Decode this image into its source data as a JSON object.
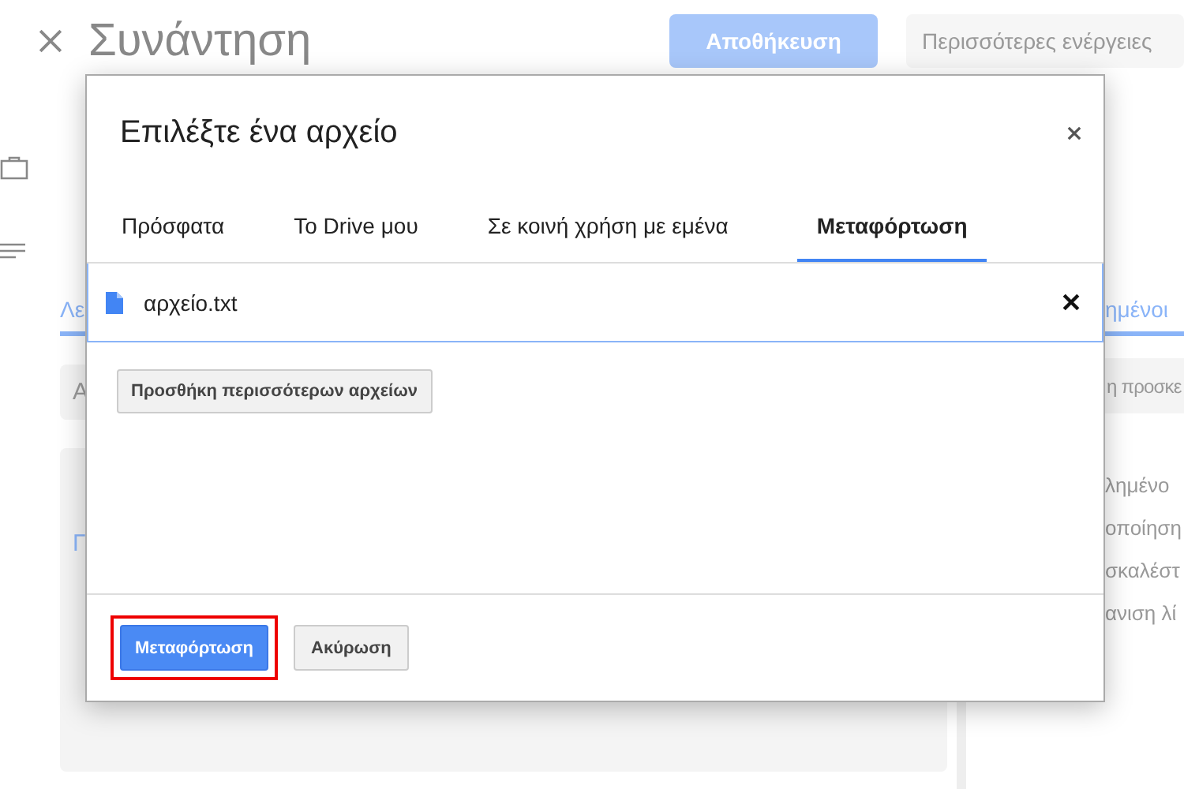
{
  "header": {
    "title": "Συνάντηση",
    "save_button": "Αποθήκευση",
    "more_actions_button": "Περισσότερες ενέργειες"
  },
  "background": {
    "left_tab": "Λε",
    "right_tab": "ημένοι",
    "left_field": "Α",
    "right_field": "η προσκε",
    "description": "Γ",
    "right_items": [
      "λημένο",
      "οποίηση",
      "σκαλέστ",
      "ανιση λί"
    ]
  },
  "dialog": {
    "title": "Επιλέξτε ένα αρχείο",
    "tabs": [
      {
        "label": "Πρόσφατα",
        "selected": false
      },
      {
        "label": "Το Drive μου",
        "selected": false
      },
      {
        "label": "Σε κοινή χρήση με εμένα",
        "selected": false
      },
      {
        "label": "Μεταφόρτωση",
        "selected": true
      }
    ],
    "files": [
      {
        "name": "αρχείο.txt"
      }
    ],
    "add_more_button": "Προσθήκη περισσότερων αρχείων",
    "upload_button": {
      "label": "Μεταφόρτωση",
      "highlighted": true
    },
    "cancel_button": "Ακύρωση"
  }
}
